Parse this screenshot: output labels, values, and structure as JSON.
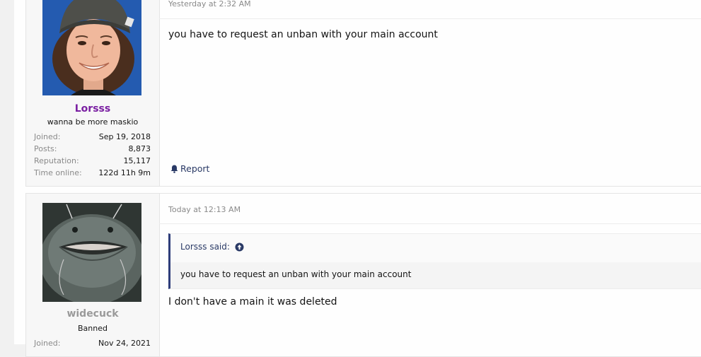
{
  "posts": [
    {
      "username": "Lorsss",
      "user_title": "wanna be more maskio",
      "stats": [
        {
          "label": "Joined:",
          "value": "Sep 19, 2018"
        },
        {
          "label": "Posts:",
          "value": "8,873"
        },
        {
          "label": "Reputation:",
          "value": "15,117"
        },
        {
          "label": "Time online:",
          "value": "122d 11h 9m"
        }
      ],
      "timestamp": "Yesterday at 2:32 AM",
      "message": "you have to request an unban with your main account",
      "report_label": "Report",
      "username_color": "#7a1fa2"
    },
    {
      "username": "widecuck",
      "user_title": "Banned",
      "stats": [
        {
          "label": "Joined:",
          "value": "Nov 24, 2021"
        }
      ],
      "timestamp": "Today at 12:13 AM",
      "quote": {
        "author_label": "Lorsss said:",
        "text": "you have to request an unban with your main account"
      },
      "message": "I don't have a main it was deleted",
      "username_color": "#9a9a9a"
    }
  ],
  "icons": {
    "report": "bell-icon",
    "quote_jump": "arrow-up-circle-icon"
  },
  "colors": {
    "accent": "#2e3d7a"
  }
}
